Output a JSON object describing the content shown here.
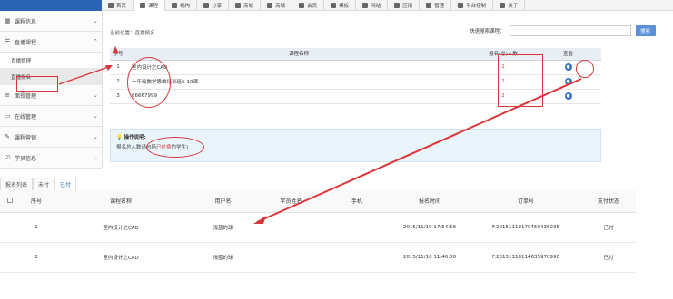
{
  "topnav": [
    {
      "label": "首页",
      "icon": "home-icon",
      "active": false
    },
    {
      "label": "课程",
      "icon": "course-icon",
      "active": true
    },
    {
      "label": "机构",
      "icon": "gear-icon",
      "active": false
    },
    {
      "label": "分享",
      "icon": "share-icon",
      "active": false
    },
    {
      "label": "商城",
      "icon": "shop-icon",
      "active": false
    },
    {
      "label": "商城",
      "icon": "shop-icon",
      "active": false
    },
    {
      "label": "会员",
      "icon": "user-icon",
      "active": false
    },
    {
      "label": "模板",
      "icon": "template-icon",
      "active": false
    },
    {
      "label": "网站",
      "icon": "tag-icon",
      "active": false
    },
    {
      "label": "应用",
      "icon": "monitor-icon",
      "active": false
    },
    {
      "label": "管理",
      "icon": "user-icon",
      "active": false
    },
    {
      "label": "平台控制",
      "icon": "control-icon",
      "active": false
    },
    {
      "label": "关于",
      "icon": "menu-icon",
      "active": false
    }
  ],
  "sidebar": {
    "groups": [
      {
        "label": "课程信息",
        "icon": "grid-icon",
        "chevron": "chevron-down"
      },
      {
        "label": "直播课程",
        "icon": "broadcast-icon",
        "chevron": "chevron-up"
      },
      {
        "label": "面授管理",
        "icon": "bars-icon",
        "chevron": "chevron-down"
      },
      {
        "label": "在线管理",
        "icon": "monitor-icon",
        "chevron": "chevron-down"
      },
      {
        "label": "课程营销",
        "icon": "wrench-icon",
        "chevron": "chevron-down"
      },
      {
        "label": "学员信息",
        "icon": "chart-icon",
        "chevron": "chevron-down"
      }
    ],
    "subitems": [
      "直播管理",
      "直播报名"
    ]
  },
  "breadcrumb": "当前位置：直播报名",
  "search": {
    "label": "快速搜索课程：",
    "placeholder": "",
    "button": "搜索"
  },
  "table1": {
    "headers": [
      "序号",
      "课程名称",
      "报名(总)人数",
      "查看"
    ],
    "rows": [
      {
        "no": "1",
        "name": "室内设计之CAD",
        "count": "2"
      },
      {
        "no": "2",
        "name": "一年级数学思维培训班6-10课",
        "count": "2"
      },
      {
        "no": "3",
        "name": "66667999",
        "count": "2"
      }
    ]
  },
  "opnote": {
    "title": "操作说明:",
    "text_prefix": "报名总人数请包括",
    "text_em": "已付费",
    "text_suffix": "的学生)"
  },
  "tabs": [
    "报名列表",
    "未付",
    "已付"
  ],
  "table2": {
    "headers": [
      "序号",
      "课程名称",
      "用户名",
      "学员姓名",
      "手机",
      "报名时间",
      "订单号",
      "支付状态"
    ],
    "rows": [
      {
        "no": "1",
        "course": "室内设计之CAD",
        "user": "浅蓝的球",
        "name": "",
        "phone": "",
        "time": "2015/11/10 17:54:56",
        "order": "F.20151110175450436235",
        "status": "已付"
      },
      {
        "no": "2",
        "course": "室内设计之CAD",
        "user": "浅蓝的球",
        "name": "",
        "phone": "",
        "time": "2015/11/10 11:46:58",
        "order": "F.20151110114635970990",
        "status": "已付"
      }
    ]
  },
  "colors": {
    "accent": "#2a63b3",
    "annotation": "#d9383b",
    "link": "#2f6cc2"
  }
}
